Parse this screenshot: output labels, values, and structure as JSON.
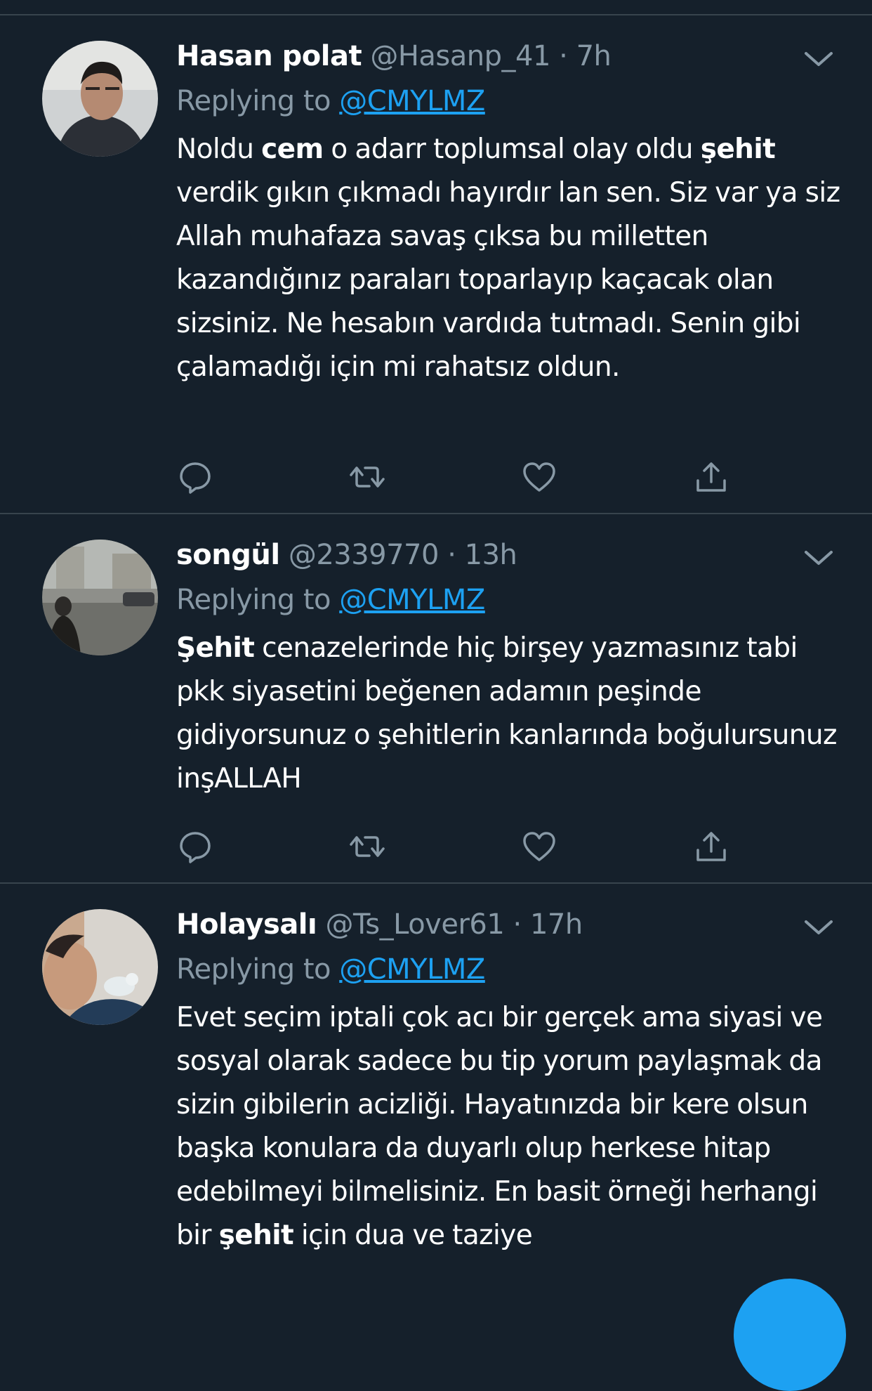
{
  "colors": {
    "background": "#15202b",
    "divider": "#38444d",
    "secondary_text": "#8899a6",
    "link": "#1da1f2",
    "fab": "#1da1f2"
  },
  "tweets": [
    {
      "name": "Hasan polat",
      "handle": "@Hasanp_41",
      "separator": "·",
      "time": "7h",
      "replying_label": "Replying to",
      "replying_handle": "@CMYLMZ",
      "text_parts": [
        {
          "t": "Noldu ",
          "b": false
        },
        {
          "t": "cem",
          "b": true
        },
        {
          "t": " o adarr toplumsal olay oldu ",
          "b": false
        },
        {
          "t": "şehit",
          "b": true
        },
        {
          "t": " verdik gıkın çıkmadı hayırdır lan sen. Siz var ya siz Allah muhafaza savaş çıksa bu milletten kazandığınız paraları toparlayıp kaçacak olan sizsiniz. Ne hesabın vardıda tutmadı. Senin gibi çalamadığı için mi rahatsız oldun.",
          "b": false
        }
      ],
      "icons": [
        "reply-icon",
        "retweet-icon",
        "like-icon",
        "share-icon"
      ]
    },
    {
      "name": "songül",
      "handle": "@2339770",
      "separator": "·",
      "time": "13h",
      "replying_label": "Replying to",
      "replying_handle": "@CMYLMZ",
      "text_parts": [
        {
          "t": "Şehit",
          "b": true
        },
        {
          "t": " cenazelerinde hiç birşey yazmasınız tabi pkk siyasetini beğenen adamın peşinde gidiyorsunuz o şehitlerin kanlarında boğulursunuz inşALLAH",
          "b": false
        }
      ],
      "icons": [
        "reply-icon",
        "retweet-icon",
        "like-icon",
        "share-icon"
      ]
    },
    {
      "name": "Holaysalı",
      "handle": "@Ts_Lover61",
      "separator": "·",
      "time": "17h",
      "replying_label": "Replying to",
      "replying_handle": "@CMYLMZ",
      "text_parts": [
        {
          "t": "Evet seçim iptali çok acı bir gerçek ama siyasi ve sosyal olarak sadece bu tip yorum paylaşmak da sizin gibilerin acizliği. Hayatınızda bir kere olsun başka konulara da duyarlı olup herkese hitap edebilmeyi bilmelisiniz. En basit örneği herhangi bir ",
          "b": false
        },
        {
          "t": "şehit",
          "b": true
        },
        {
          "t": " için dua ve taziye",
          "b": false
        }
      ],
      "icons": [
        "reply-icon",
        "retweet-icon",
        "like-icon",
        "share-icon"
      ]
    }
  ]
}
